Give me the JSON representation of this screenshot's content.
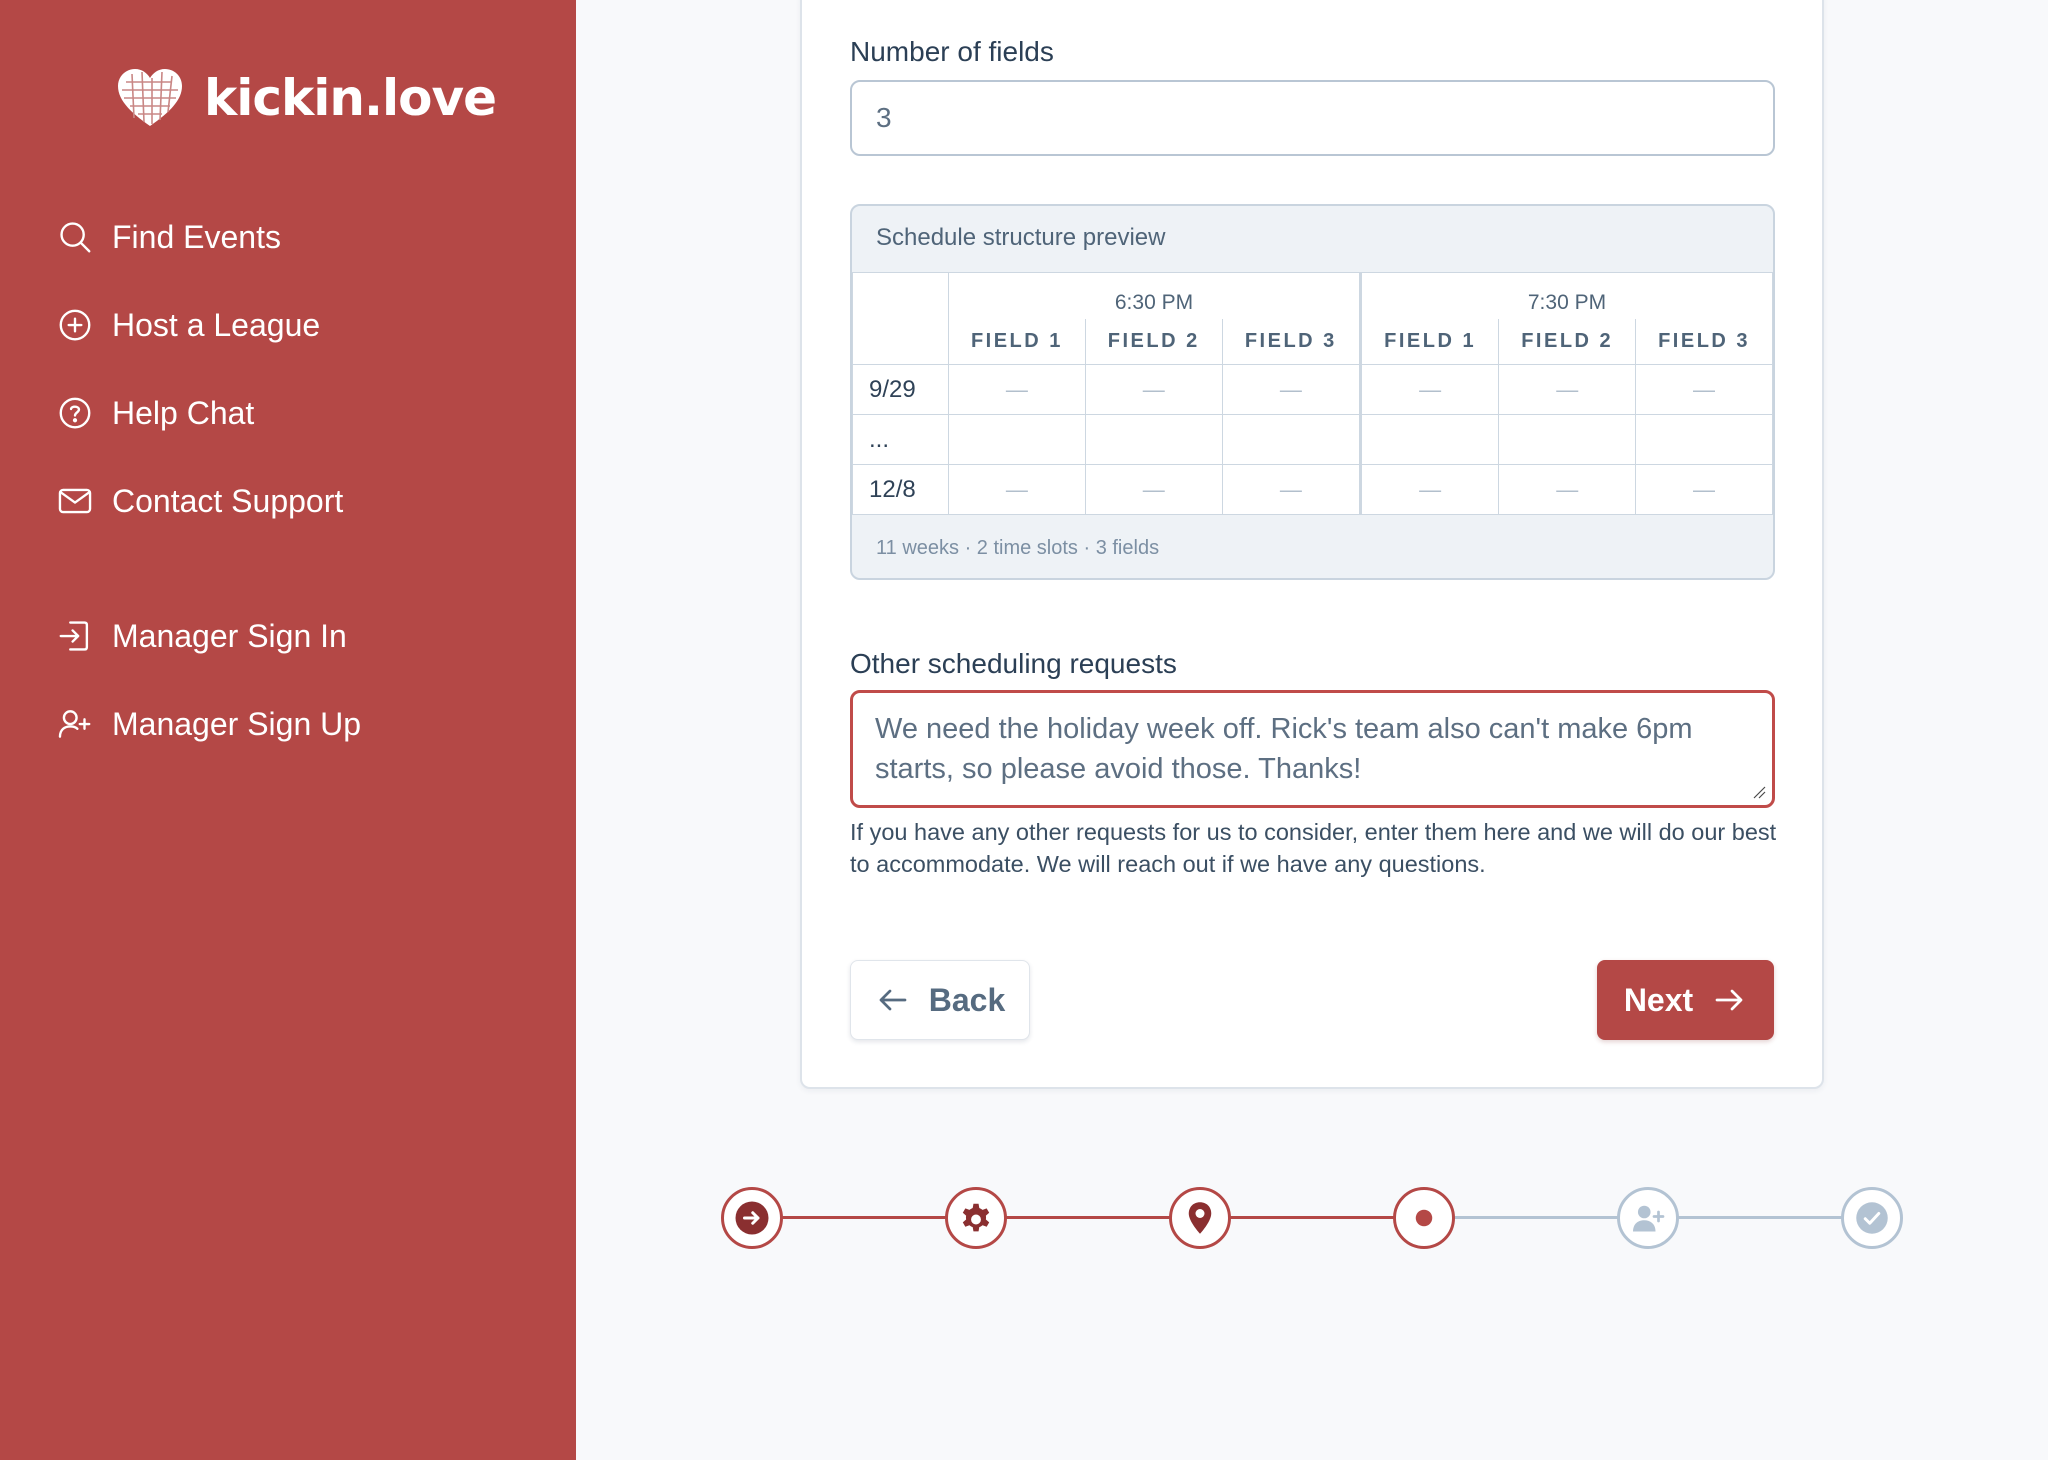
{
  "app": {
    "brand": "kickin.love"
  },
  "sidebar": {
    "items": [
      {
        "label": "Find Events",
        "icon": "search-icon"
      },
      {
        "label": "Host a League",
        "icon": "plus-circle-icon"
      },
      {
        "label": "Help Chat",
        "icon": "question-circle-icon"
      },
      {
        "label": "Contact Support",
        "icon": "envelope-icon"
      },
      {
        "label": "Manager Sign In",
        "icon": "sign-in-icon"
      },
      {
        "label": "Manager Sign Up",
        "icon": "user-plus-icon"
      }
    ]
  },
  "form": {
    "num_fields_label": "Number of fields",
    "num_fields_value": "3",
    "preview": {
      "title": "Schedule structure preview",
      "time_slots": [
        "6:30 PM",
        "7:30 PM"
      ],
      "field_headers": [
        "FIELD 1",
        "FIELD 2",
        "FIELD 3",
        "FIELD 1",
        "FIELD 2",
        "FIELD 3"
      ],
      "rows": [
        {
          "date": "9/29",
          "cells": [
            "—",
            "—",
            "—",
            "—",
            "—",
            "—"
          ]
        },
        {
          "date": "...",
          "cells": [
            "",
            "",
            "",
            "",
            "",
            ""
          ]
        },
        {
          "date": "12/8",
          "cells": [
            "—",
            "—",
            "—",
            "—",
            "—",
            "—"
          ]
        }
      ],
      "summary": "11 weeks · 2 time slots · 3 fields"
    },
    "requests_label": "Other scheduling requests",
    "requests_value": "We need the holiday week off. Rick's team also can't make 6pm starts, so please avoid those. Thanks!",
    "requests_helper": "If you have any other requests for us to consider, enter them here and we will do our best to accommodate. We will reach out if we have any questions.",
    "back_label": "Back",
    "next_label": "Next"
  },
  "stepper": {
    "steps": [
      {
        "icon": "arrow-right-circle-icon",
        "state": "complete"
      },
      {
        "icon": "gear-icon",
        "state": "complete"
      },
      {
        "icon": "map-pin-icon",
        "state": "complete"
      },
      {
        "icon": "dot-icon",
        "state": "current"
      },
      {
        "icon": "user-plus-icon",
        "state": "upcoming"
      },
      {
        "icon": "check-circle-icon",
        "state": "upcoming"
      }
    ]
  },
  "colors": {
    "brand_red": "#b44846",
    "dark_red": "#8a2f30",
    "muted_blue": "#b3c3d3",
    "text": "#2f4257"
  }
}
